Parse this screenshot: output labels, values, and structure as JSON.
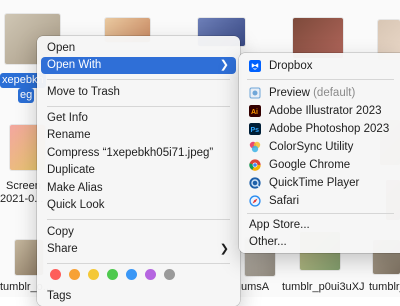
{
  "files": [
    {
      "name": "xepebkh",
      "name2": "eg"
    },
    {
      "name": "Screen",
      "name2": "2021-0..."
    },
    {
      "name": "tumblr_o...",
      "name2": ""
    },
    {
      "name": "umsA",
      "name2": ""
    },
    {
      "name": "tumblr_p0ui3uXJ",
      "name2": ""
    },
    {
      "name": "tumblr_...",
      "name2": ""
    }
  ],
  "context_menu": {
    "items": [
      {
        "label": "Open"
      },
      {
        "label": "Open With"
      },
      {
        "label": "Move to Trash"
      },
      {
        "label": "Get Info"
      },
      {
        "label": "Rename"
      },
      {
        "label": "Compress “1xepebkh05i71.jpeg”"
      },
      {
        "label": "Duplicate"
      },
      {
        "label": "Make Alias"
      },
      {
        "label": "Quick Look"
      },
      {
        "label": "Copy"
      },
      {
        "label": "Share"
      },
      {
        "label": "Tags"
      }
    ],
    "tag_colors": [
      "#fe5d5a",
      "#f7a135",
      "#f4c836",
      "#4ec94e",
      "#3a97f6",
      "#b565e0",
      "#9a9a9a"
    ],
    "highlight_color": "#2f6fd7"
  },
  "submenu": {
    "items": [
      {
        "label": "Dropbox",
        "suffix": "",
        "icon": "dropbox-icon",
        "color": "#0061fe"
      },
      {
        "label": "Preview",
        "suffix": " (default)",
        "icon": "preview-icon",
        "color": "#6fa6d8"
      },
      {
        "label": "Adobe Illustrator 2023",
        "suffix": "",
        "icon": "illustrator-icon",
        "color": "#330000"
      },
      {
        "label": "Adobe Photoshop 2023",
        "suffix": "",
        "icon": "photoshop-icon",
        "color": "#001e36"
      },
      {
        "label": "ColorSync Utility",
        "suffix": "",
        "icon": "colorsync-icon",
        "color": "#e05a9a"
      },
      {
        "label": "Google Chrome",
        "suffix": "",
        "icon": "chrome-icon",
        "color": "#db4437"
      },
      {
        "label": "QuickTime Player",
        "suffix": "",
        "icon": "quicktime-icon",
        "color": "#1e5fa8"
      },
      {
        "label": "Safari",
        "suffix": "",
        "icon": "safari-icon",
        "color": "#2a8cf0"
      },
      {
        "label": "App Store...",
        "suffix": "",
        "icon": "",
        "color": ""
      },
      {
        "label": "Other...",
        "suffix": "",
        "icon": "",
        "color": ""
      }
    ]
  }
}
